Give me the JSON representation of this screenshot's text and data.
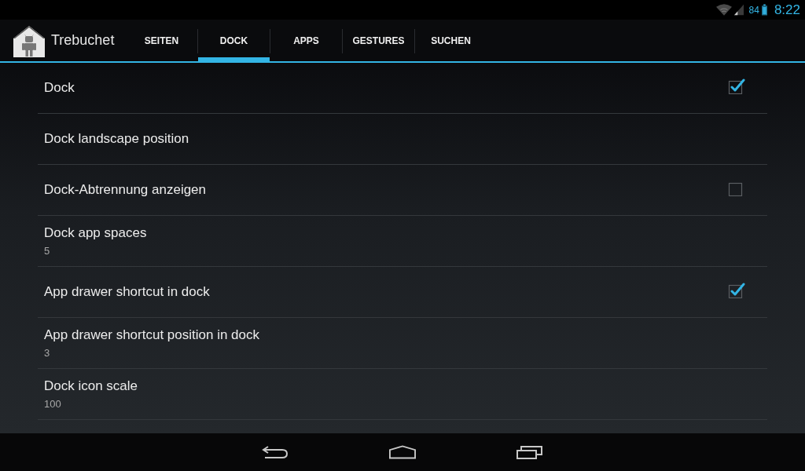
{
  "status_bar": {
    "battery": "84",
    "time": "8:22"
  },
  "action_bar": {
    "title": "Trebuchet"
  },
  "tabs": [
    {
      "label": "SEITEN",
      "selected": false
    },
    {
      "label": "DOCK",
      "selected": true
    },
    {
      "label": "APPS",
      "selected": false
    },
    {
      "label": "GESTURES",
      "selected": false
    },
    {
      "label": "SUCHEN",
      "selected": false
    }
  ],
  "settings": [
    {
      "kind": "checkbox",
      "title": "Dock",
      "checked": true
    },
    {
      "kind": "text",
      "title": "Dock landscape position"
    },
    {
      "kind": "checkbox",
      "title": "Dock-Abtrennung anzeigen",
      "checked": false
    },
    {
      "kind": "text",
      "title": "Dock app spaces",
      "summary": "5"
    },
    {
      "kind": "checkbox",
      "title": "App drawer shortcut in dock",
      "checked": true
    },
    {
      "kind": "text",
      "title": "App drawer shortcut position in dock",
      "summary": "3"
    },
    {
      "kind": "text",
      "title": "Dock icon scale",
      "summary": "100"
    }
  ]
}
